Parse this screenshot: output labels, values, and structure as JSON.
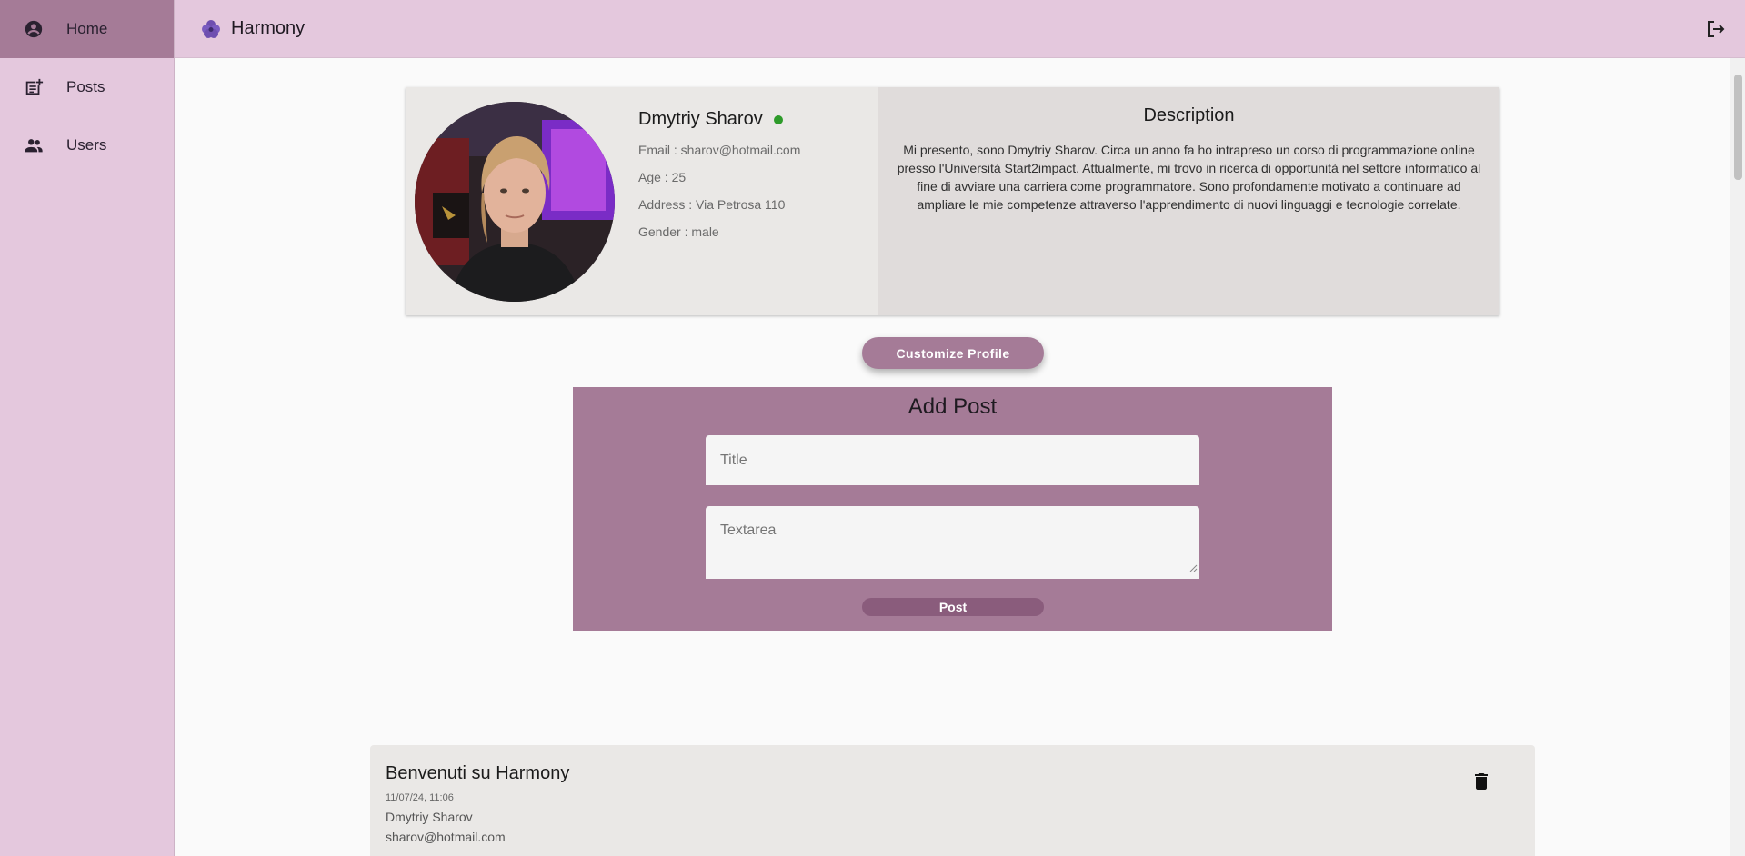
{
  "sidebar": {
    "items": [
      {
        "label": "Home",
        "icon": "account-circle-icon",
        "active": true
      },
      {
        "label": "Posts",
        "icon": "post-add-icon",
        "active": false
      },
      {
        "label": "Users",
        "icon": "group-icon",
        "active": false
      }
    ]
  },
  "header": {
    "title": "Harmony",
    "logo_icon": "flower-icon",
    "logout_icon": "logout-icon"
  },
  "profile": {
    "name": "Dmytriy Sharov",
    "status": "online",
    "email": "Email : sharov@hotmail.com",
    "age": "Age : 25",
    "address": "Address : Via Petrosa 110",
    "gender": "Gender : male",
    "description_title": "Description",
    "description": "Mi presento, sono Dmytriy Sharov. Circa un anno fa ho intrapreso un corso di programmazione online presso l'Università Start2impact. Attualmente, mi trovo in ricerca di opportunità nel settore informatico al fine di avviare una carriera come programmatore. Sono profondamente motivato a continuare ad ampliare le mie competenze attraverso l'apprendimento di nuovi linguaggi e tecnologie correlate."
  },
  "customize_button": "Customize Profile",
  "add_post": {
    "title": "Add Post",
    "title_placeholder": "Title",
    "textarea_placeholder": "Textarea",
    "submit_label": "Post"
  },
  "posts": [
    {
      "title": "Benvenuti su Harmony",
      "date": "11/07/24, 11:06",
      "author": "Dmytriy Sharov",
      "email": "sharov@hotmail.com"
    }
  ],
  "colors": {
    "sidebar_bg": "#e4c8dd",
    "accent": "#a57b97",
    "online": "#2e9b2a"
  }
}
